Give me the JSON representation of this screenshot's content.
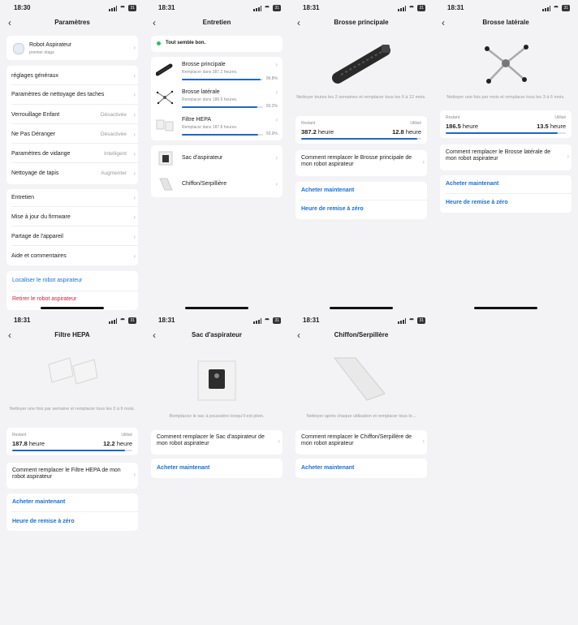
{
  "screens": {
    "settings": {
      "time": "18:30",
      "title": "Paramètres",
      "device_name": "Robot Aspirateur",
      "device_sub": "premier étage",
      "items": [
        {
          "label": "réglages généraux",
          "value": ""
        },
        {
          "label": "Paramètres de nettoyage des taches",
          "value": ""
        },
        {
          "label": "Verrouillage Enfant",
          "value": "Désactivée"
        },
        {
          "label": "Ne Pas Déranger",
          "value": "Désactivée"
        },
        {
          "label": "Paramètres de vidange",
          "value": "Intelligent"
        },
        {
          "label": "Nettoyage de tapis",
          "value": "Augmenter"
        }
      ],
      "items2": [
        {
          "label": "Entretien"
        },
        {
          "label": "Mise à jour du firmware"
        },
        {
          "label": "Partage de l'appareil"
        },
        {
          "label": "Aide et commentaires"
        }
      ],
      "locate": "Localiser le robot aspirateur",
      "remove": "Retirer le robot aspirateur"
    },
    "maintenance": {
      "time": "18:31",
      "title": "Entretien",
      "status": "Tout semble bon.",
      "status_color": "#22c55e",
      "parts": [
        {
          "name": "Brosse principale",
          "sub": "Remplacer dans 387.2 heures.",
          "pct": "96.8%",
          "level": 0.968
        },
        {
          "name": "Brosse latérale",
          "sub": "Remplacer dans 186.5 heures.",
          "pct": "93.2%",
          "level": 0.932
        },
        {
          "name": "Filtre HEPA",
          "sub": "Remplacer dans 187.8 heures.",
          "pct": "93.9%",
          "level": 0.939
        }
      ],
      "other": [
        {
          "name": "Sac d'aspirateur"
        },
        {
          "name": "Chiffon/Serpillière"
        }
      ]
    },
    "main_brush": {
      "time": "18:31",
      "title": "Brosse principale",
      "desc": "Nettoyer toutes les 2 semaines et remplacer tous les 6 à 12 mois.",
      "remaining_label": "Restant",
      "used_label": "Utilisé",
      "remaining": "387.2",
      "used": "12.8",
      "unit": "heure",
      "level": 0.968,
      "how": "Comment remplacer le Brosse principale de mon robot aspirateur",
      "buy": "Acheter maintenant",
      "reset": "Heure de remise à zéro"
    },
    "side_brush": {
      "time": "18:31",
      "title": "Brosse latérale",
      "desc": "Nettoyer une fois par mois et remplacer tous les 3 à 6 mois.",
      "remaining_label": "Restant",
      "used_label": "Utilisé",
      "remaining": "186.5",
      "used": "13.5",
      "unit": "heure",
      "level": 0.932,
      "how": "Comment remplacer le Brosse latérale de mon robot aspirateur",
      "buy": "Acheter maintenant",
      "reset": "Heure de remise à zéro"
    },
    "hepa": {
      "time": "18:31",
      "title": "Filtre HEPA",
      "desc": "Nettoyer une fois par semaine et remplacer tous les 3 à 6 mois.",
      "remaining_label": "Restant",
      "used_label": "Utilisé",
      "remaining": "187.8",
      "used": "12.2",
      "unit": "heure",
      "level": 0.939,
      "how": "Comment remplacer le Filtre HEPA de mon robot aspirateur",
      "buy": "Acheter maintenant",
      "reset": "Heure de remise à zéro"
    },
    "bag": {
      "time": "18:31",
      "title": "Sac d'aspirateur",
      "desc": "Remplacez le sac à poussière lorsqu'il est plein.",
      "how": "Comment remplacer le Sac d'aspirateur de mon robot aspirateur",
      "buy": "Acheter maintenant"
    },
    "mop": {
      "time": "18:31",
      "title": "Chiffon/Serpillère",
      "desc": "Nettoyer après chaque utilisation et remplacer tous le...",
      "how": "Comment remplacer le Chiffon/Serpillère de mon robot aspirateur",
      "buy": "Acheter maintenant"
    }
  }
}
